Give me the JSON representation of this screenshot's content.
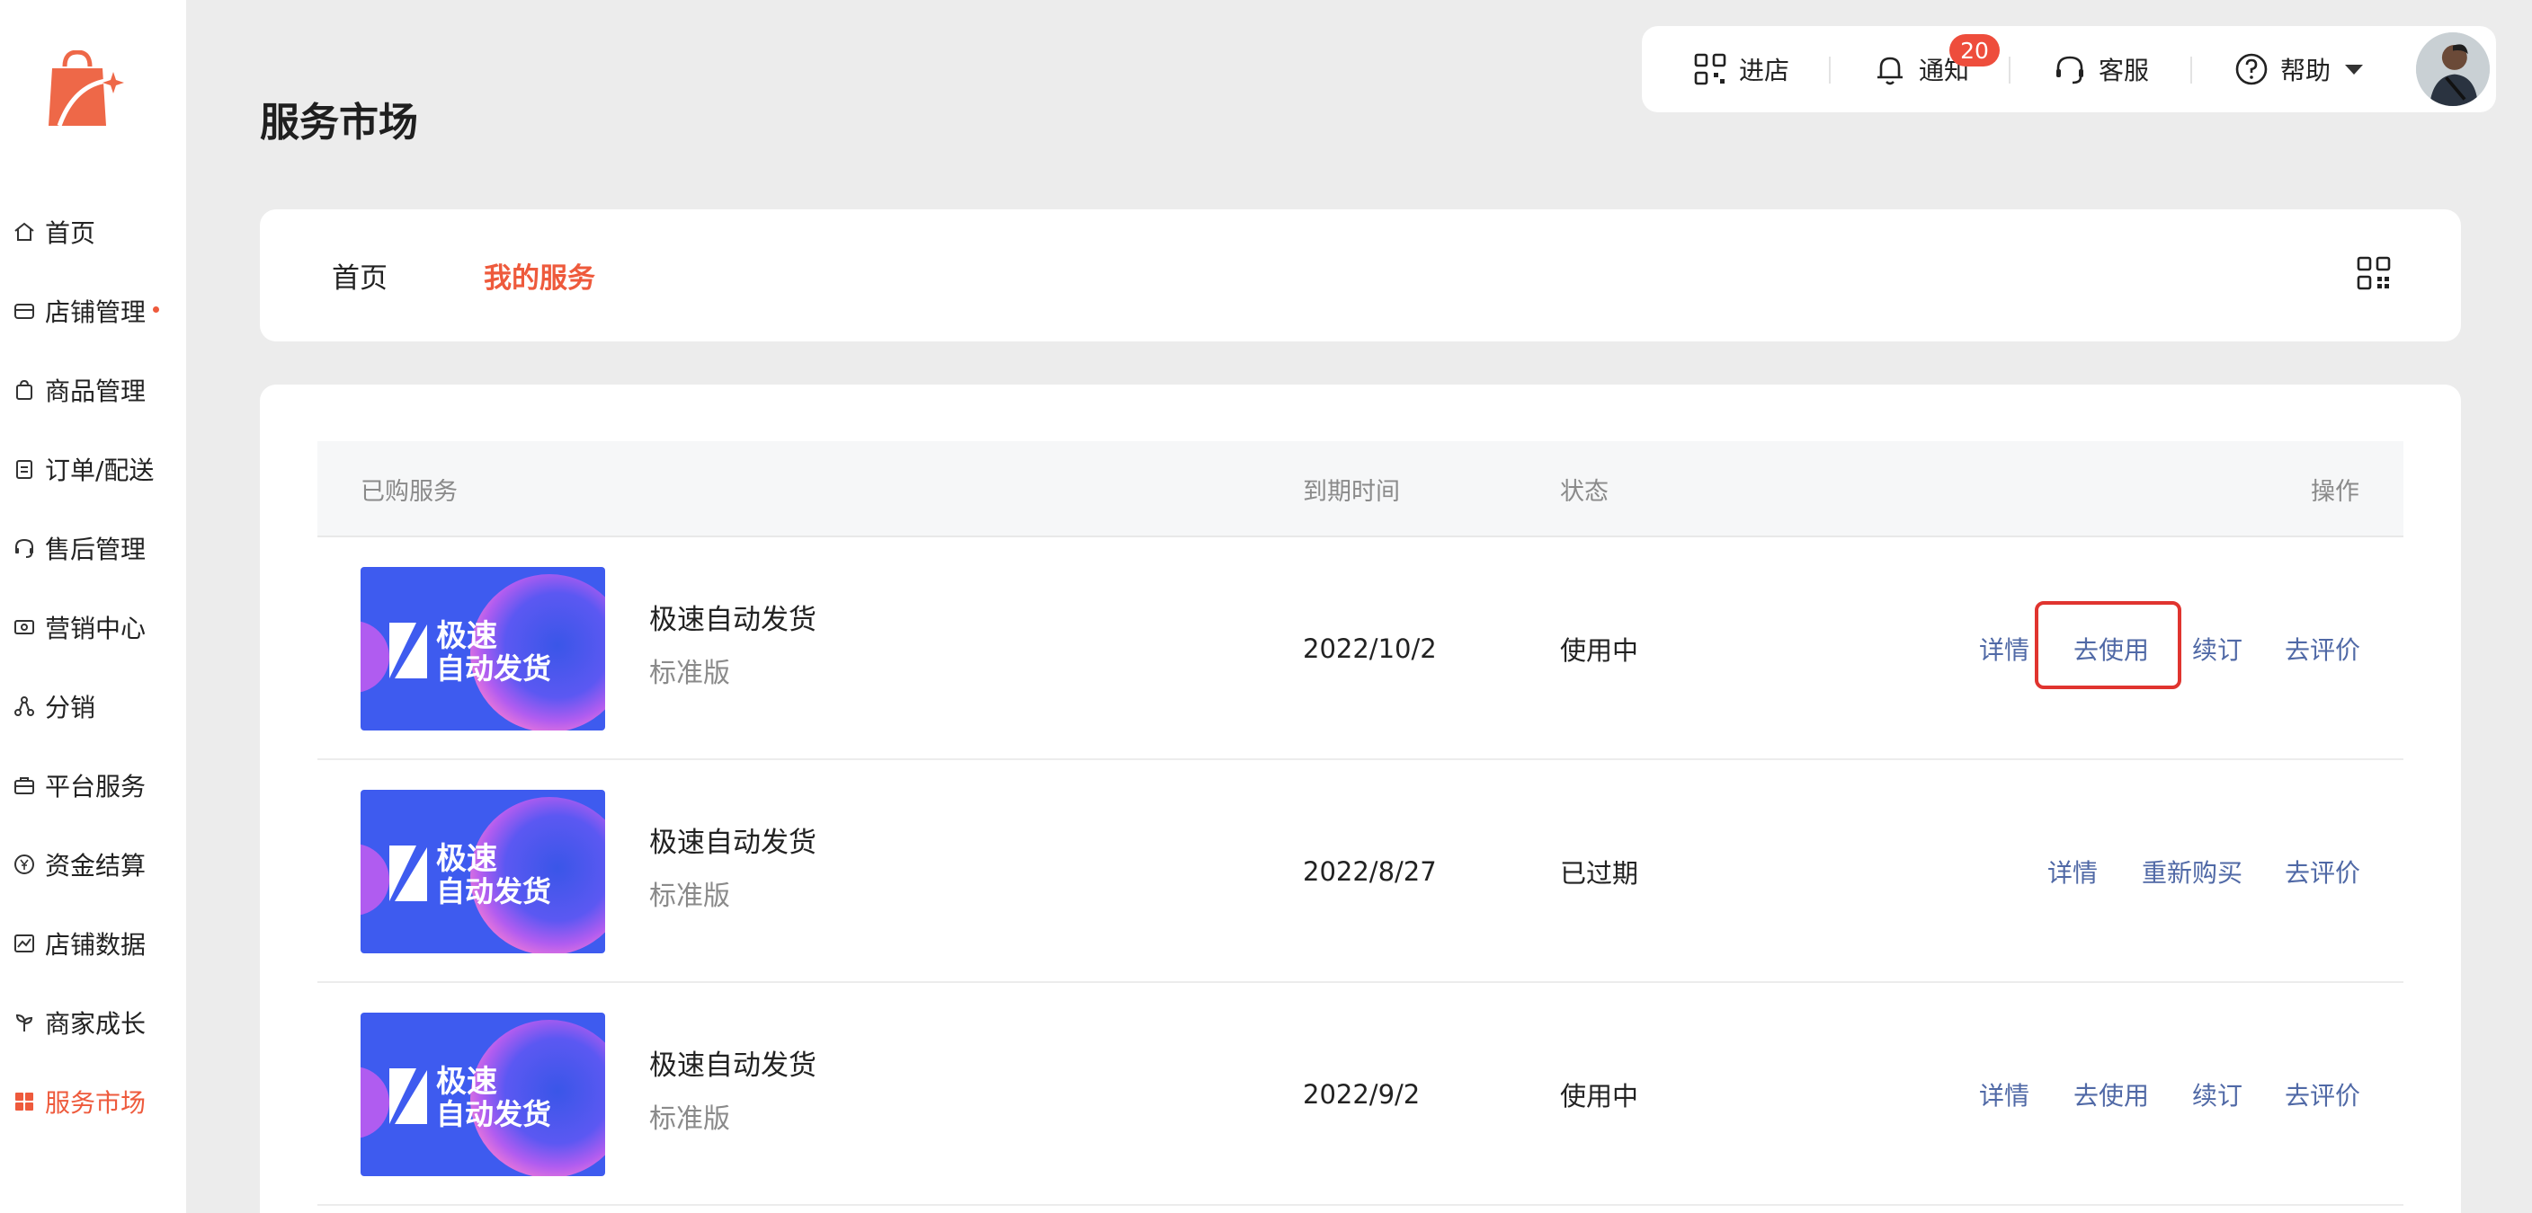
{
  "page_title": "服务市场",
  "toolbar": {
    "enter_store": "进店",
    "notify": "通知",
    "notify_count": "20",
    "service": "客服",
    "help": "帮助"
  },
  "sidebar": {
    "items": [
      {
        "label": "首页",
        "icon": "home-icon"
      },
      {
        "label": "店铺管理",
        "icon": "store-icon",
        "dot": true
      },
      {
        "label": "商品管理",
        "icon": "bag-icon"
      },
      {
        "label": "订单/配送",
        "icon": "clipboard-icon"
      },
      {
        "label": "售后管理",
        "icon": "headset-icon"
      },
      {
        "label": "营销中心",
        "icon": "ticket-icon"
      },
      {
        "label": "分销",
        "icon": "share-nodes-icon"
      },
      {
        "label": "平台服务",
        "icon": "briefcase-icon"
      },
      {
        "label": "资金结算",
        "icon": "yen-icon"
      },
      {
        "label": "店铺数据",
        "icon": "chart-icon"
      },
      {
        "label": "商家成长",
        "icon": "sprout-icon"
      },
      {
        "label": "服务市场",
        "icon": "grid-icon",
        "active": true
      }
    ]
  },
  "tabs": [
    {
      "label": "首页"
    },
    {
      "label": "我的服务",
      "active": true
    }
  ],
  "table": {
    "headers": {
      "service": "已购服务",
      "expiry": "到期时间",
      "status": "状态",
      "actions": "操作"
    },
    "rows": [
      {
        "name": "极速自动发货",
        "edition": "标准版",
        "expiry": "2022/10/2",
        "status": "使用中",
        "actions": [
          "详情",
          "去使用",
          "续订",
          "去评价"
        ]
      },
      {
        "name": "极速自动发货",
        "edition": "标准版",
        "expiry": "2022/8/27",
        "status": "已过期",
        "actions": [
          "详情",
          "重新购买",
          "去评价"
        ]
      },
      {
        "name": "极速自动发货",
        "edition": "标准版",
        "expiry": "2022/9/2",
        "status": "使用中",
        "actions": [
          "详情",
          "去使用",
          "续订",
          "去评价"
        ]
      }
    ],
    "thumb_text_line1": "极速",
    "thumb_text_line2": "自动发货"
  },
  "colors": {
    "accent": "#ee5a3c",
    "link": "#5069a6",
    "highlight": "#e0342f",
    "thumb_bg": "#3e5bef"
  }
}
